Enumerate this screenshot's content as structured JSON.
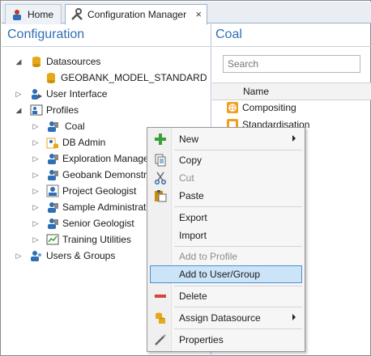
{
  "tabs": [
    {
      "label": "Home",
      "icon": "home-icon"
    },
    {
      "label": "Configuration Manager",
      "icon": "tools-icon",
      "close": "×"
    }
  ],
  "left_pane": {
    "title": "Configuration",
    "tree": [
      {
        "label": "Datasources",
        "icon": "database-icon",
        "expander": "◢",
        "level": 0
      },
      {
        "label": "GEOBANK_MODEL_STANDARD",
        "icon": "database-small-icon",
        "expander": "",
        "level": 1
      },
      {
        "label": "User Interface",
        "icon": "user-interface-icon",
        "expander": "▷",
        "level": 0
      },
      {
        "label": "Profiles",
        "icon": "profiles-icon",
        "expander": "◢",
        "level": 0
      },
      {
        "label": "Coal",
        "icon": "profile-icon",
        "expander": "▷",
        "level": 1,
        "selected": true
      },
      {
        "label": "DB Admin",
        "icon": "db-admin-icon",
        "expander": "▷",
        "level": 1
      },
      {
        "label": "Exploration Manage",
        "icon": "profile-icon",
        "expander": "▷",
        "level": 1
      },
      {
        "label": "Geobank Demonstrat",
        "icon": "profile-icon",
        "expander": "▷",
        "level": 1
      },
      {
        "label": "Project Geologist",
        "icon": "project-geologist-icon",
        "expander": "▷",
        "level": 1
      },
      {
        "label": "Sample Administrati",
        "icon": "profile-icon",
        "expander": "▷",
        "level": 1
      },
      {
        "label": "Senior Geologist",
        "icon": "profile-icon",
        "expander": "▷",
        "level": 1
      },
      {
        "label": "Training Utilities",
        "icon": "training-icon",
        "expander": "▷",
        "level": 1
      },
      {
        "label": "Users & Groups",
        "icon": "users-icon",
        "expander": "▷",
        "level": 0
      }
    ]
  },
  "right_pane": {
    "title": "Coal",
    "search_placeholder": "Search",
    "column_name": "Name",
    "rows": [
      {
        "label": "Compositing",
        "icon": "compositing-icon"
      },
      {
        "label": "Standardisation",
        "icon": "standardisation-icon"
      }
    ]
  },
  "context_menu": {
    "items": [
      {
        "label": "New",
        "icon": "plus-icon",
        "submenu": true,
        "disabled": false
      },
      {
        "sep": true
      },
      {
        "label": "Copy",
        "icon": "copy-icon",
        "disabled": false
      },
      {
        "label": "Cut",
        "icon": "cut-icon",
        "disabled": true
      },
      {
        "label": "Paste",
        "icon": "paste-icon",
        "disabled": false
      },
      {
        "sep": true
      },
      {
        "label": "Export",
        "icon": "",
        "disabled": false
      },
      {
        "label": "Import",
        "icon": "",
        "disabled": false
      },
      {
        "sep": true
      },
      {
        "label": "Add to Profile",
        "icon": "",
        "disabled": true
      },
      {
        "label": "Add to User/Group",
        "icon": "",
        "disabled": false,
        "hover": true
      },
      {
        "sep": true
      },
      {
        "label": "Delete",
        "icon": "delete-icon",
        "disabled": false
      },
      {
        "sep": true
      },
      {
        "label": "Assign Datasource",
        "icon": "datasource-icon",
        "submenu": true,
        "disabled": false
      },
      {
        "sep": true
      },
      {
        "label": "Properties",
        "icon": "properties-icon",
        "disabled": false
      }
    ]
  },
  "colors": {
    "accent_title": "#2e6fb5",
    "menu_hover": "#cce4f7",
    "delete_red": "#d64541",
    "plus_green": "#3a9e3a"
  }
}
